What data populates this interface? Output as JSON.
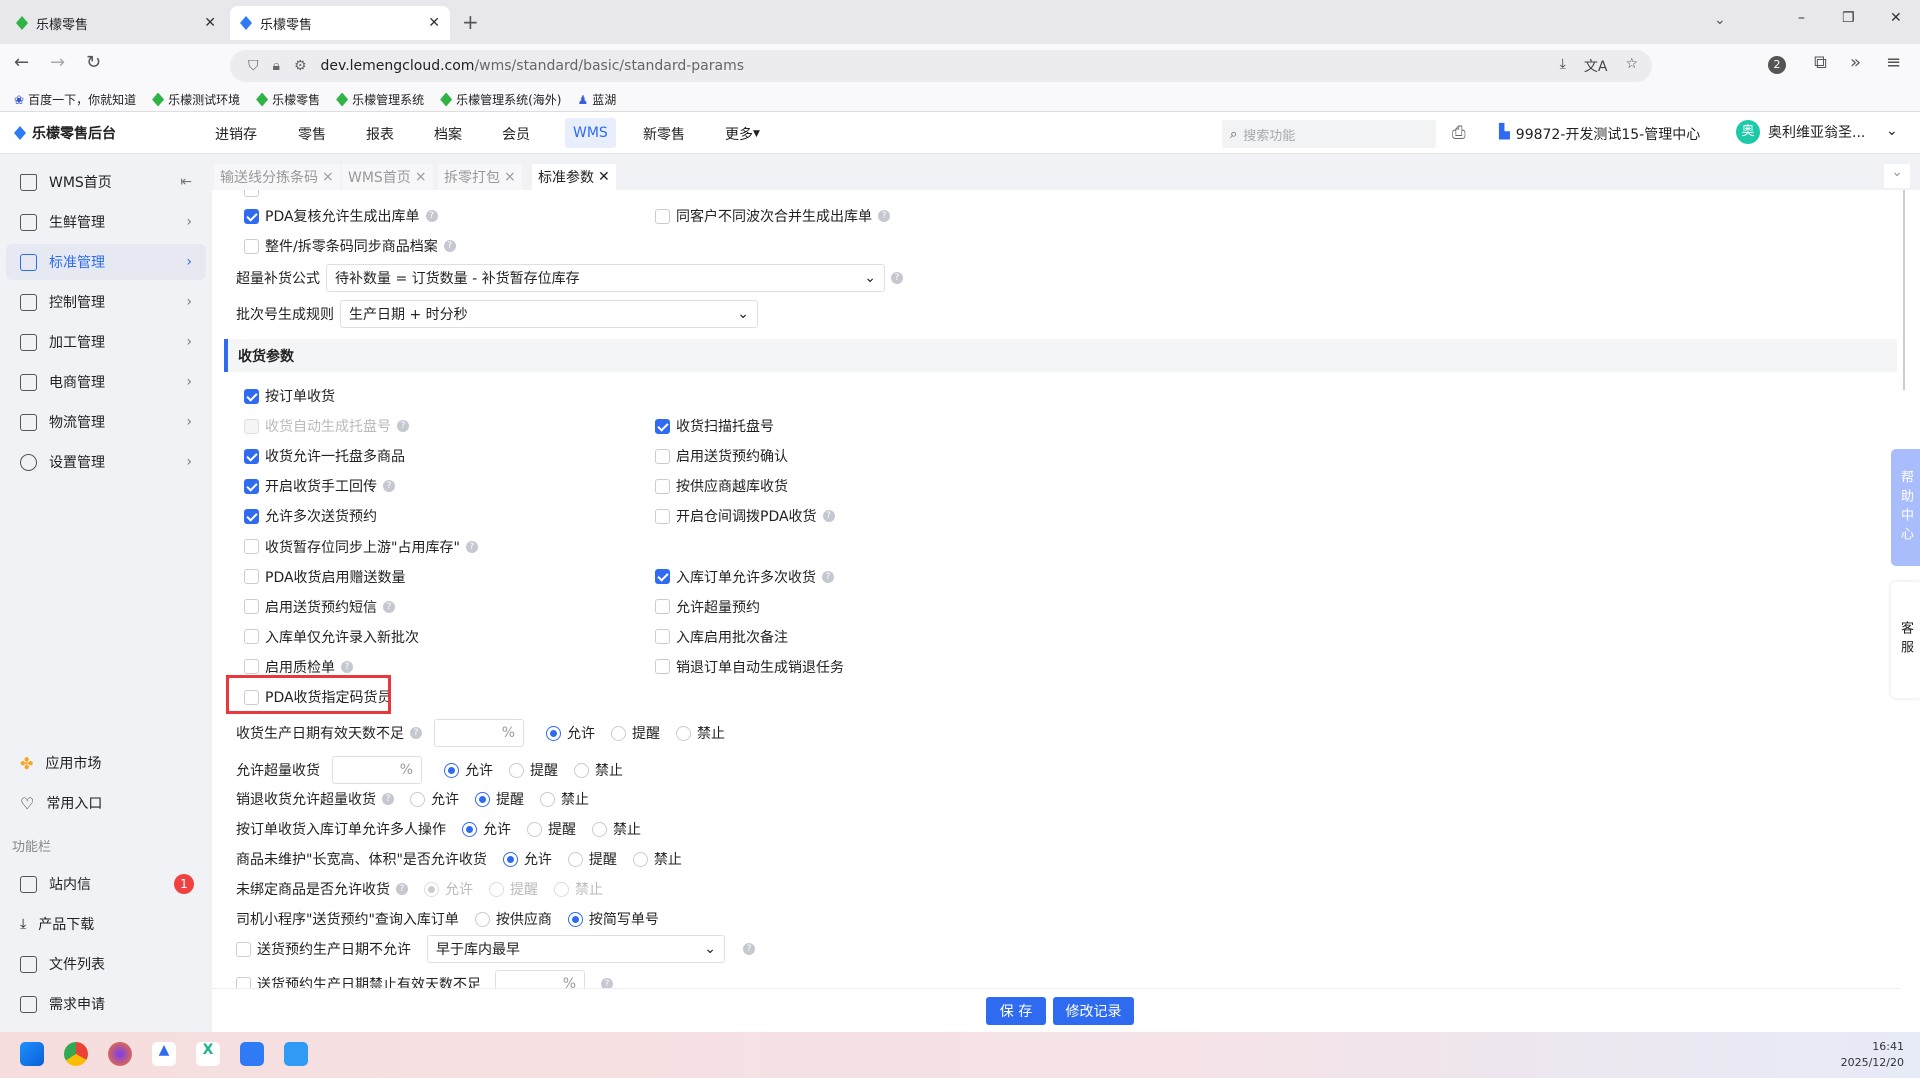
{
  "browser": {
    "tabs": [
      {
        "title": "乐檬零售"
      },
      {
        "title": "乐檬零售"
      }
    ],
    "new_tab": "+",
    "url_host": "dev.lemengcloud.com",
    "url_path": "/wms/standard/basic/standard-params",
    "ext_badge": "2",
    "bookmarks": [
      "百度一下，你就知道",
      "乐檬测试环境",
      "乐檬零售",
      "乐檬管理系统",
      "乐檬管理系统(海外)",
      "蓝湖"
    ]
  },
  "app": {
    "logo": "乐檬零售后台",
    "nav": [
      "进销存",
      "零售",
      "报表",
      "档案",
      "会员",
      "WMS",
      "新零售",
      "更多"
    ],
    "search_placeholder": "搜索功能",
    "store": "99872-开发测试15-管理中心",
    "avatar_char": "奥",
    "user": "奥利维亚翁圣..."
  },
  "sidebar": {
    "items": [
      {
        "label": "WMS首页"
      },
      {
        "label": "生鲜管理"
      },
      {
        "label": "标准管理"
      },
      {
        "label": "控制管理"
      },
      {
        "label": "加工管理"
      },
      {
        "label": "电商管理"
      },
      {
        "label": "物流管理"
      },
      {
        "label": "设置管理"
      }
    ],
    "bottom": [
      {
        "label": "应用市场"
      },
      {
        "label": "常用入口"
      }
    ],
    "section": "功能栏",
    "tools": [
      {
        "label": "站内信",
        "badge": "1"
      },
      {
        "label": "产品下载"
      },
      {
        "label": "文件列表"
      },
      {
        "label": "需求申请"
      }
    ]
  },
  "page_tabs": [
    "输送线分拣条码",
    "WMS首页",
    "拆零打包",
    "标准参数"
  ],
  "top_settings": {
    "pda_review": {
      "label": "PDA复核允许生成出库单",
      "checked": true
    },
    "same_customer": {
      "label": "同客户不同波次合并生成出库单",
      "checked": false
    },
    "barcode_sync": {
      "label": "整件/拆零条码同步商品档案",
      "checked": false
    },
    "replenish_label": "超量补货公式",
    "replenish_value": "待补数量 = 订货数量 - 补货暂存位库存",
    "batch_label": "批次号生成规则",
    "batch_value": "生产日期 + 时分秒"
  },
  "receiving": {
    "title": "收货参数",
    "checkboxes": [
      [
        {
          "label": "按订单收货",
          "checked": true
        },
        null
      ],
      [
        {
          "label": "收货自动生成托盘号",
          "checked": false,
          "disabled": true,
          "help": true
        },
        {
          "label": "收货扫描托盘号",
          "checked": true
        }
      ],
      [
        {
          "label": "收货允许一托盘多商品",
          "checked": true
        },
        {
          "label": "启用送货预约确认",
          "checked": false
        }
      ],
      [
        {
          "label": "开启收货手工回传",
          "checked": true,
          "help": true
        },
        {
          "label": "按供应商越库收货",
          "checked": false
        }
      ],
      [
        {
          "label": "允许多次送货预约",
          "checked": true
        },
        {
          "label": "开启仓间调拨PDA收货",
          "checked": false,
          "help": true
        }
      ],
      [
        {
          "label": "收货暂存位同步上游\"占用库存\"",
          "checked": false,
          "help": true
        },
        null
      ],
      [
        {
          "label": "PDA收货启用赠送数量",
          "checked": false
        },
        {
          "label": "入库订单允许多次收货",
          "checked": true,
          "help": true
        }
      ],
      [
        {
          "label": "启用送货预约短信",
          "checked": false,
          "help": true
        },
        {
          "label": "允许超量预约",
          "checked": false
        }
      ],
      [
        {
          "label": "入库单仅允许录入新批次",
          "checked": false
        },
        {
          "label": "入库启用批次备注",
          "checked": false
        }
      ],
      [
        {
          "label": "启用质检单",
          "checked": false,
          "help": true
        },
        {
          "label": "销退订单自动生成销退任务",
          "checked": false
        }
      ],
      [
        {
          "label": "PDA收货指定码货员",
          "checked": false,
          "highlighted": true
        },
        null
      ]
    ],
    "radios": [
      {
        "label": "收货生产日期有效天数不足",
        "help": true,
        "input_unit": "%",
        "input_value": "",
        "options": [
          "允许",
          "提醒",
          "禁止"
        ],
        "selected": "允许"
      },
      {
        "label": "允许超量收货",
        "input_unit": "%",
        "input_value": "",
        "options": [
          "允许",
          "提醒",
          "禁止"
        ],
        "selected": "允许"
      },
      {
        "label": "销退收货允许超量收货",
        "help": true,
        "options": [
          "允许",
          "提醒",
          "禁止"
        ],
        "selected": "提醒"
      },
      {
        "label": "按订单收货入库订单允许多人操作",
        "options": [
          "允许",
          "提醒",
          "禁止"
        ],
        "selected": "允许"
      },
      {
        "label": "商品未维护\"长宽高、体积\"是否允许收货",
        "options": [
          "允许",
          "提醒",
          "禁止"
        ],
        "selected": "允许"
      },
      {
        "label": "未绑定商品是否允许收货",
        "help": true,
        "disabled": true,
        "options": [
          "允许",
          "提醒",
          "禁止"
        ],
        "selected": "允许"
      },
      {
        "label": "司机小程序\"送货预约\"查询入库订单",
        "options": [
          "按供应商",
          "按简写单号"
        ],
        "selected": "按简写单号"
      }
    ],
    "delivery_date": {
      "label": "送货预约生产日期不允许",
      "checked": false,
      "select": "早于库内最早"
    },
    "delivery_days": {
      "label": "送货预约生产日期禁止有效天数不足",
      "checked": false,
      "input_unit": "%"
    }
  },
  "footer": {
    "save": "保 存",
    "history": "修改记录"
  },
  "float": {
    "help": "帮助中心",
    "service": "客服"
  },
  "taskbar": {
    "time": "16:41",
    "date": "2025/12/20"
  },
  "colors": {
    "primary": "#2f6bf0",
    "highlight": "#e8383d"
  }
}
